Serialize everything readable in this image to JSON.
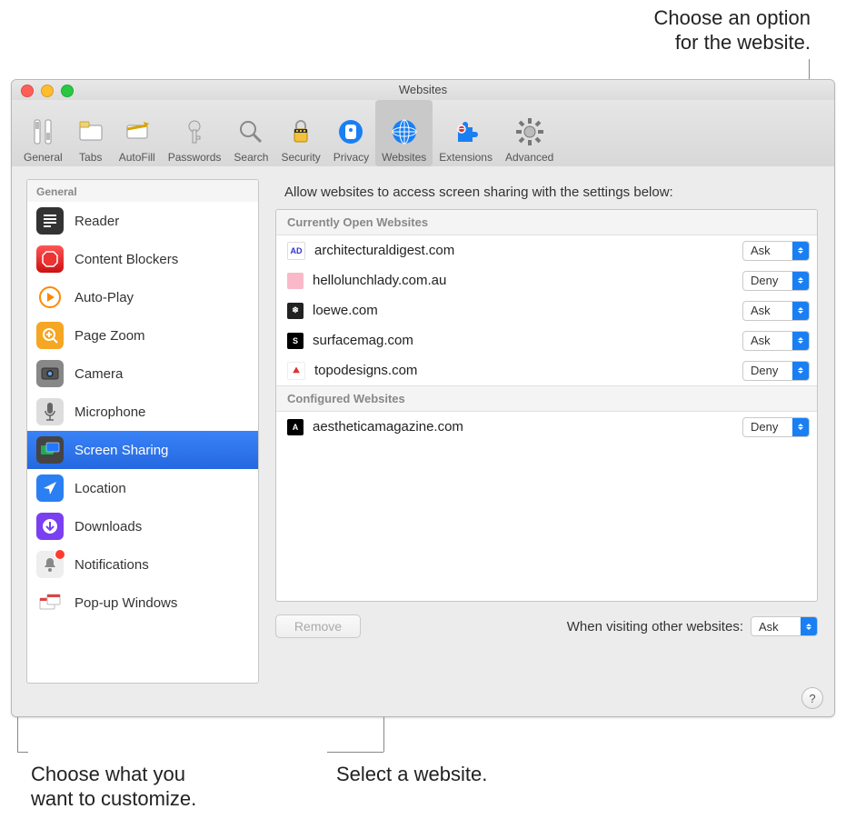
{
  "callouts": {
    "top_right_l1": "Choose an option",
    "top_right_l2": "for the website.",
    "bottom_left_l1": "Choose what you",
    "bottom_left_l2": "want to customize.",
    "bottom_mid": "Select a website."
  },
  "window": {
    "title": "Websites"
  },
  "toolbar": [
    {
      "id": "general",
      "label": "General"
    },
    {
      "id": "tabs",
      "label": "Tabs"
    },
    {
      "id": "autofill",
      "label": "AutoFill"
    },
    {
      "id": "passwords",
      "label": "Passwords"
    },
    {
      "id": "search",
      "label": "Search"
    },
    {
      "id": "security",
      "label": "Security"
    },
    {
      "id": "privacy",
      "label": "Privacy"
    },
    {
      "id": "websites",
      "label": "Websites",
      "selected": true
    },
    {
      "id": "extensions",
      "label": "Extensions"
    },
    {
      "id": "advanced",
      "label": "Advanced"
    }
  ],
  "sidebar": {
    "header": "General",
    "items": [
      {
        "id": "reader",
        "label": "Reader",
        "icon": "reader"
      },
      {
        "id": "content-blockers",
        "label": "Content Blockers",
        "icon": "stop"
      },
      {
        "id": "auto-play",
        "label": "Auto-Play",
        "icon": "play"
      },
      {
        "id": "page-zoom",
        "label": "Page Zoom",
        "icon": "zoom"
      },
      {
        "id": "camera",
        "label": "Camera",
        "icon": "camera"
      },
      {
        "id": "microphone",
        "label": "Microphone",
        "icon": "mic"
      },
      {
        "id": "screen-sharing",
        "label": "Screen Sharing",
        "icon": "screens",
        "selected": true
      },
      {
        "id": "location",
        "label": "Location",
        "icon": "location"
      },
      {
        "id": "downloads",
        "label": "Downloads",
        "icon": "download"
      },
      {
        "id": "notifications",
        "label": "Notifications",
        "icon": "bell",
        "badge": true
      },
      {
        "id": "popups",
        "label": "Pop-up Windows",
        "icon": "popup"
      }
    ]
  },
  "content": {
    "description": "Allow websites to access screen sharing with the settings below:",
    "groups": [
      {
        "header": "Currently Open Websites",
        "rows": [
          {
            "domain": "architecturaldigest.com",
            "value": "Ask",
            "favicon": {
              "bg": "#fff",
              "fg": "#3131d6",
              "txt": "AD",
              "border": "1px solid #ddd"
            }
          },
          {
            "domain": "hellolunchlady.com.au",
            "value": "Deny",
            "favicon": {
              "bg": "#f9b9c8",
              "fg": "#fff",
              "txt": ""
            }
          },
          {
            "domain": "loewe.com",
            "value": "Ask",
            "favicon": {
              "bg": "#222",
              "fg": "#fff",
              "txt": "❄"
            }
          },
          {
            "domain": "surfacemag.com",
            "value": "Ask",
            "favicon": {
              "bg": "#000",
              "fg": "#fff",
              "txt": "S"
            }
          },
          {
            "domain": "topodesigns.com",
            "value": "Deny",
            "favicon": {
              "bg": "#fff",
              "fg": "#d33",
              "txt": "⛰",
              "border": "1px solid #eee"
            }
          }
        ]
      },
      {
        "header": "Configured Websites",
        "rows": [
          {
            "domain": "aestheticamagazine.com",
            "value": "Deny",
            "favicon": {
              "bg": "#000",
              "fg": "#fff",
              "txt": "A"
            }
          }
        ]
      }
    ],
    "remove_label": "Remove",
    "other_label": "When visiting other websites:",
    "other_value": "Ask"
  },
  "help": "?"
}
